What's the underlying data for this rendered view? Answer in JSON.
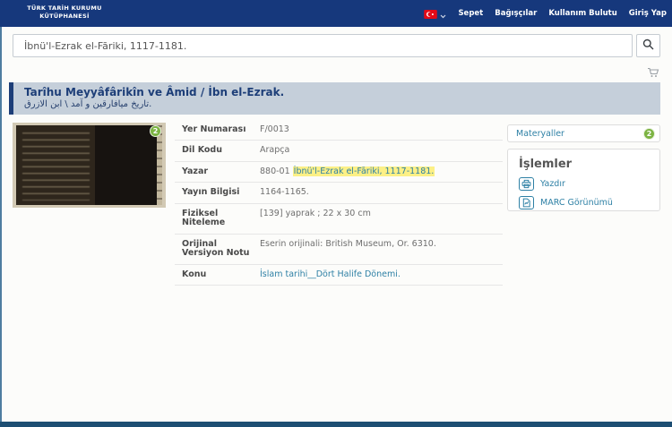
{
  "header": {
    "logo": {
      "line1": "TÜRK TARİH KURUMU",
      "line2": "KÜTÜPHANESİ"
    },
    "nav": [
      {
        "label": "Sepet"
      },
      {
        "label": "Bağışçılar"
      },
      {
        "label": "Kullanım Bulutu"
      },
      {
        "label": "Giriş Yap"
      }
    ]
  },
  "search": {
    "value": "İbnü'l-Ezrak el-Fāriki, 1117-1181."
  },
  "banner": {
    "title": "Tarîhu Meyyâfârikîn ve Âmid / İbn el-Ezrak.",
    "title_arabic": "تاريخ ميافارقين و آمد \\ ابن الازرق."
  },
  "record": {
    "image_badge_count": "2",
    "fields": [
      {
        "label": "Yer Numarası",
        "value": "F/0013"
      },
      {
        "label": "Dil Kodu",
        "value": "Arapça"
      },
      {
        "label": "Yazar",
        "value_prefix": "880-01 ",
        "value_link": "İbnü'l-Ezrak el-Fāriki, 1117-1181."
      },
      {
        "label": "Yayın Bilgisi",
        "value": "1164-1165."
      },
      {
        "label": "Fiziksel Niteleme",
        "value": "[139] yaprak ; 22 x 30 cm"
      },
      {
        "label": "Orijinal Versiyon Notu",
        "value": "Eserin orijinali: British Museum, Or. 6310."
      },
      {
        "label": "Konu",
        "value": "İslam tarihi__Dört Halife Dönemi."
      }
    ]
  },
  "sidebar": {
    "materials": {
      "label": "Materyaller",
      "count": "2"
    },
    "actions": {
      "title": "İşlemler",
      "items": [
        {
          "label": "Yazdır"
        },
        {
          "label": "MARC Görünümü"
        }
      ]
    }
  },
  "icons": {
    "turkish-flag": "red flag with white crescent and star",
    "chevron-down": "language dropdown arrow",
    "search": "magnifying glass",
    "cart": "shopping cart",
    "printer": "print action",
    "marc-document": "document with chart lines"
  },
  "colors": {
    "header_bg": "#16387c",
    "banner_bg": "#c5cfda",
    "banner_text": "#1d3e78",
    "link_teal": "#2e80a5",
    "badge_green": "#7cb342",
    "highlight_yellow": "#fcf086",
    "footer_bar": "#1d4e73",
    "edge_line": "#4e7da0"
  }
}
